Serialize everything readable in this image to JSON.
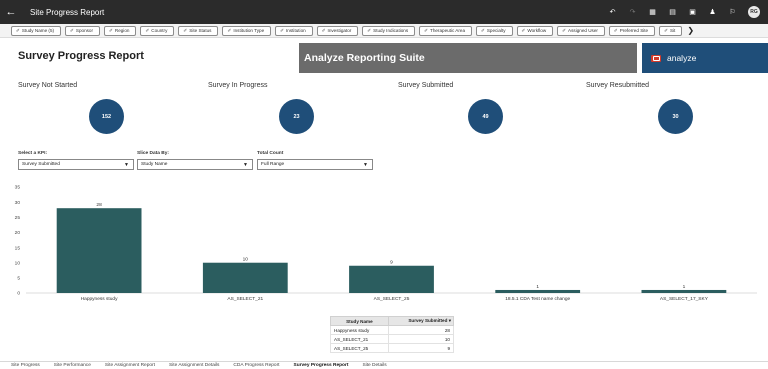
{
  "window": {
    "back": "←",
    "title": "Site Progress Report",
    "avatar": "RG"
  },
  "toolbar_icons": [
    "undo-icon",
    "redo-icon",
    "grid-icon",
    "present-icon",
    "export-icon",
    "person-icon",
    "bookmark-icon"
  ],
  "filters": [
    "Study Name (5)",
    "Sponsor",
    "Region",
    "Country",
    "Site Status",
    "Institution Type",
    "Institution",
    "Investigator",
    "Study Indications",
    "Therapeutic Area",
    "Specialty",
    "Workflow",
    "Assigned User",
    "Preferred Site",
    "Sit"
  ],
  "filters_more": "❯",
  "header": {
    "report_title": "Survey Progress Report",
    "banner": "Analyze Reporting Suite",
    "brand": "analyze"
  },
  "kpis": [
    {
      "label": "Survey Not Started",
      "value": "152"
    },
    {
      "label": "Survey In Progress",
      "value": "23"
    },
    {
      "label": "Survey Submitted",
      "value": "49"
    },
    {
      "label": "Survey Resubmitted",
      "value": "30"
    }
  ],
  "controls": {
    "kpi_label": "Select a KPI:",
    "kpi_value": "Survey Submitted",
    "slice_label": "Slice Data By:",
    "slice_value": "Study Name",
    "count_label": "Total Count",
    "count_value": "Full Range"
  },
  "chart_data": {
    "type": "bar",
    "categories": [
      "Happyness study",
      "AS_SELECT_21",
      "AS_SELECT_25",
      "18.5.1 CDA Test name change",
      "AS_SELECT_17_SKY"
    ],
    "values": [
      28,
      10,
      9,
      1,
      1
    ],
    "ylim": [
      0,
      35
    ],
    "yticks": [
      0,
      5,
      10,
      15,
      20,
      25,
      30,
      35
    ],
    "bar_color": "#2b5d5f",
    "grid": false
  },
  "table": {
    "headers": [
      "Study Name",
      "Survey Submitted"
    ],
    "rows": [
      [
        "Happyness study",
        "28"
      ],
      [
        "AS_SELECT_21",
        "10"
      ],
      [
        "AS_SELECT_25",
        "9"
      ]
    ]
  },
  "tabs": [
    {
      "label": "Site Progress",
      "active": false
    },
    {
      "label": "Site Performance",
      "active": false
    },
    {
      "label": "Site Assignment Report",
      "active": false
    },
    {
      "label": "Site Assignment Details",
      "active": false
    },
    {
      "label": "CDA Progress Report",
      "active": false
    },
    {
      "label": "Survey Progress Report",
      "active": true
    },
    {
      "label": "Site Details",
      "active": false
    }
  ]
}
